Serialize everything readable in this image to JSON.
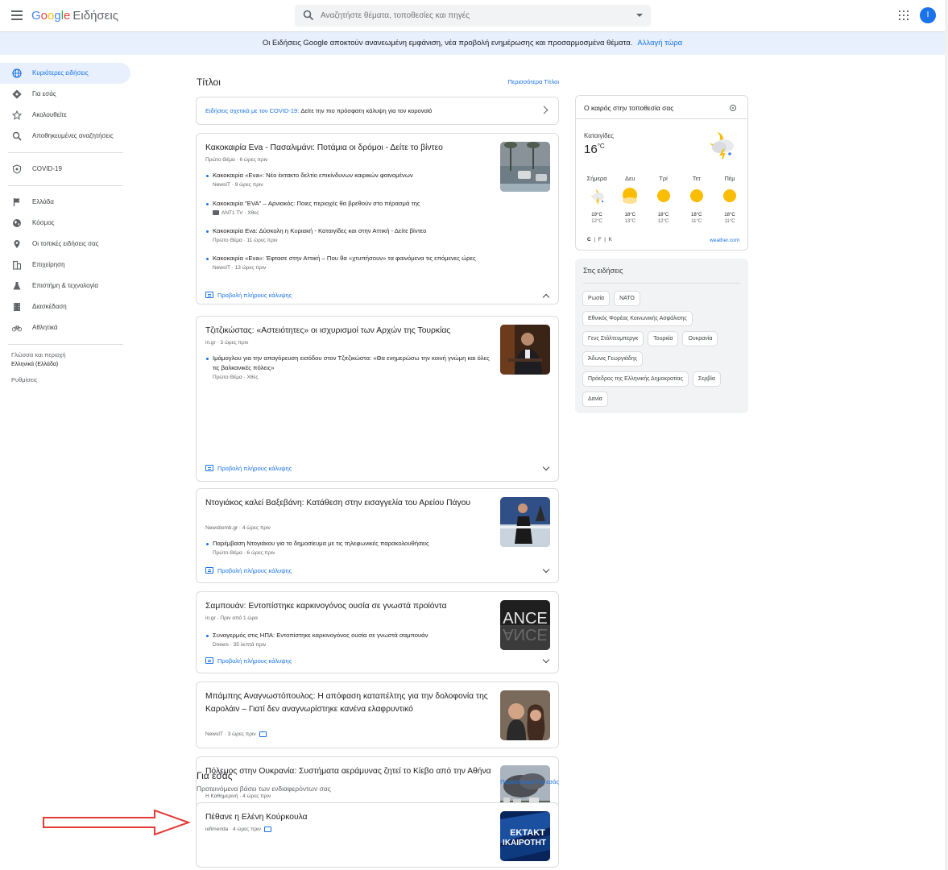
{
  "header": {
    "logo_letters": [
      "G",
      "o",
      "o",
      "g",
      "l",
      "e"
    ],
    "product": "Ειδήσεις",
    "search_placeholder": "Αναζητήστε θέματα, τοποθεσίες και πηγές",
    "avatar_letter": "I"
  },
  "banner": {
    "text": "Οι Ειδήσεις Google αποκτούν ανανεωμένη εμφάνιση, νέα προβολή ενημέρωσης και προσαρμοσμένα θέματα.",
    "link": "Αλλαγή τώρα"
  },
  "sidebar": {
    "items": [
      {
        "label": "Κυριότερες ειδήσεις",
        "icon": "globe-icon"
      },
      {
        "label": "Για εσάς",
        "icon": "diamond-icon"
      },
      {
        "label": "Ακολουθείτε",
        "icon": "star-icon"
      },
      {
        "label": "Αποθηκευμένες αναζητήσεις",
        "icon": "search-icon"
      },
      {
        "label": "COVID-19",
        "icon": "shield-icon"
      },
      {
        "label": "Ελλάδα",
        "icon": "flag-icon"
      },
      {
        "label": "Κόσμος",
        "icon": "world-icon"
      },
      {
        "label": "Οι τοπικές ειδήσεις σας",
        "icon": "pin-icon"
      },
      {
        "label": "Επιχείρηση",
        "icon": "building-icon"
      },
      {
        "label": "Επιστήμη & τεχνολογία",
        "icon": "flask-icon"
      },
      {
        "label": "Διασκέδαση",
        "icon": "film-icon"
      },
      {
        "label": "Αθλητικά",
        "icon": "bike-icon"
      }
    ],
    "language_label": "Γλώσσα και περιοχή",
    "language_value": "Ελληνικά (Ελλάδα)",
    "settings": "Ρυθμίσεις"
  },
  "headlines": {
    "title": "Τίτλοι",
    "more": "Περισσότερα Τίτλοι",
    "covid_link": "Ειδήσεις σχετικά με τον COVID-19:",
    "covid_text": " Δείτε την πιο πρόσφατη κάλυψη για τον κορονοϊό",
    "full_coverage": "Προβολή πλήρους κάλυψης",
    "stories": [
      {
        "title": "Κακοκαιρία Eva - Πασαλιμάνι: Ποτάμια οι δρόμοι - Δείτε το βίντεο",
        "meta": "Πρώτο Θέμα · 6 ώρες πριν",
        "subs": [
          {
            "title": "Κακοκαιρία «Eva»: Νέο έκτακτο δελτίο επικίνδυνων καιρικών φαινομένων",
            "meta": "NewsIT · 9 ώρες πριν"
          },
          {
            "title": "Κακοκαιρία \"EVA\" – Αρνιακός: Ποιες περιοχές θα βρεθούν στο πέρασμά της",
            "meta": "ANT1 TV · Χθες"
          },
          {
            "title": "Κακοκαιρία Eva: Δύσκολη η Κυριακή - Καταιγίδες και στην Αττική - Δείτε βίντεο",
            "meta": "Πρώτο Θέμα · 11 ώρες πριν"
          },
          {
            "title": "Κακοκαιρία «Eva»: Έφτασε στην Αττική – Που θα «χτυπήσουν» τα φαινόμενα τις επόμενες ώρες",
            "meta": "NewsIT · 13 ώρες πριν"
          }
        ]
      },
      {
        "title": "Τζιτζικώστας: «Αστειότητες» οι ισχυρισμοί των Αρχών της Τουρκίας",
        "meta": "in.gr · 3 ώρες πριν",
        "subs": [
          {
            "title": "Ιμάμογλου για την απαγόρευση εισόδου στον Τζιτζικώστα: «Θα ενημερώσω την κοινή γνώμη και όλες τις βαλκανικές πόλεις»",
            "meta": "Πρώτο Θέμα · Χθες"
          }
        ]
      },
      {
        "title": "Ντογιάκος καλεί Βαξεβάνη: Κατάθεση στην εισαγγελία του Αρείου Πάγου",
        "meta": "Newsbomb.gr · 4 ώρες πριν",
        "subs": [
          {
            "title": "Παρέμβαση Ντογιάκου για το δημοσίευμα με τις τηλεφωνικές παρακολουθήσεις",
            "meta": "Πρώτο Θέμα · 6 ώρες πριν"
          }
        ]
      },
      {
        "title": "Σαμπουάν: Εντοπίστηκε καρκινογόνος ουσία σε γνωστά προϊόντα",
        "meta": "in.gr · Πριν από 1 ώρα",
        "subs": [
          {
            "title": "Συναγερμός στις ΗΠΑ: Εντοπίστηκε καρκινογόνος ουσία σε γνωστά σαμπουάν",
            "meta": "Dnews · 35 λεπτά πριν"
          }
        ]
      },
      {
        "title": "Μπάμπης Αναγνωστόπουλος: Η απόφαση καταπέλτης για την δολοφονία της Καρολάιν – Γιατί δεν αναγνωρίστηκε κανένα ελαφρυντικό",
        "meta": "NewsIT · 3 ώρες πριν"
      },
      {
        "title": "Πόλεμος στην Ουκρανία: Συστήματα αεράμυνας ζητεί το Κίεβο από την Αθήνα",
        "meta": "Η Καθημερινή · 4 ώρες πριν"
      }
    ]
  },
  "for_you": {
    "title": "Για εσάς",
    "subtitle": "Προτεινόμενα βάσει των ενδιαφερόντων σας",
    "more": "Περισσότερα Για εσάς",
    "story_title": "Πέθανε η Ελένη Κούρκουλα",
    "story_meta": "iefimerida · 4 ώρες πριν",
    "thumb_text_1": "ΕΚΤΑΚΤ",
    "thumb_text_2": "ΙΚΑΙΡΟΤΗΤ"
  },
  "thumb_text": "ANCE",
  "weather": {
    "title": "Ο καιρός στην τοποθεσία σας",
    "condition": "Καταιγίδες",
    "temp": "16",
    "unit": "°C",
    "days": [
      {
        "name": "Σήμερα",
        "hi": "19°C",
        "lo": "12°C",
        "icon": "storm-icon"
      },
      {
        "name": "Δευ",
        "hi": "18°C",
        "lo": "13°C",
        "icon": "partly-sunny-icon"
      },
      {
        "name": "Τρί",
        "hi": "18°C",
        "lo": "12°C",
        "icon": "sun-icon"
      },
      {
        "name": "Τετ",
        "hi": "18°C",
        "lo": "11°C",
        "icon": "sun-icon"
      },
      {
        "name": "Πέμ",
        "hi": "18°C",
        "lo": "11°C",
        "icon": "sun-icon"
      }
    ],
    "units": [
      "C",
      "F",
      "K"
    ],
    "source": "weather.com"
  },
  "trends": {
    "title": "Στις ειδήσεις",
    "chips": [
      "Ρωσία",
      "ΝΑΤΟ",
      "Εθνικός Φορέας Κοινωνικής Ασφάλισης",
      "Γενς Στόλτενμπεργκ",
      "Τουρκία",
      "Ουκρανία",
      "Άδωνις Γεωργιάδης",
      "Πρόεδρος της Ελληνικής Δημοκρατίας",
      "Σερβία",
      "Δανία"
    ]
  },
  "colors": {
    "accent": "#1a73e8",
    "banner": "#e8f0fe",
    "arrow": "#e53935"
  }
}
